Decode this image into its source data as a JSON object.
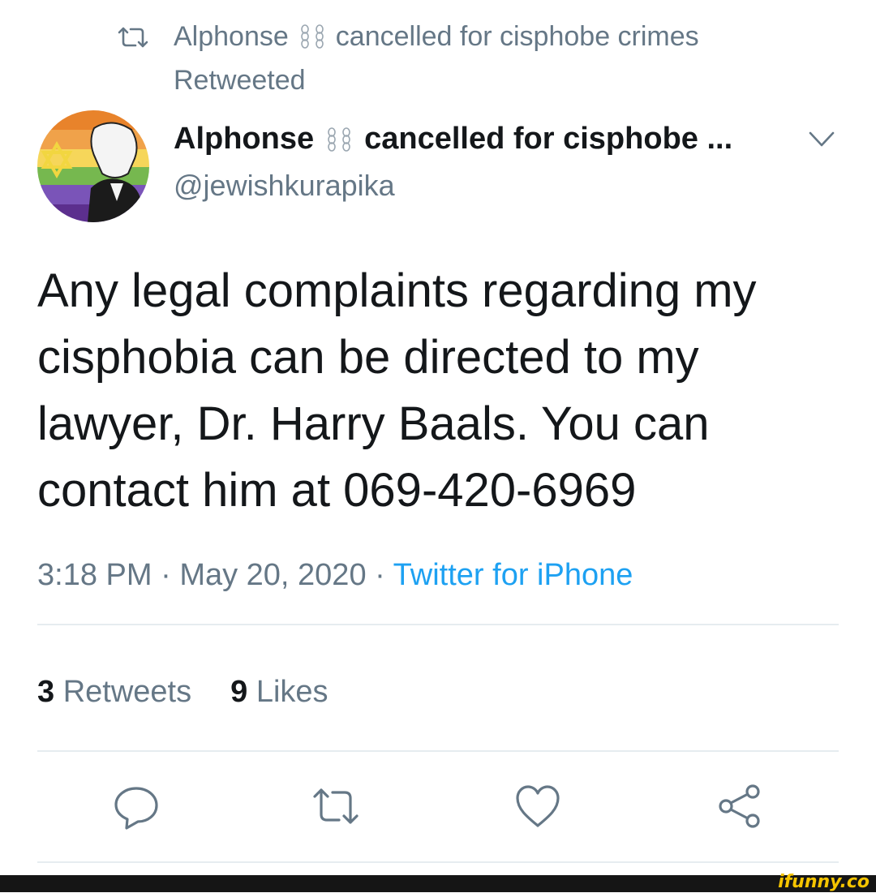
{
  "retweet_header": {
    "name_left": "Alphonse",
    "name_right": "cancelled for cisphobe crimes",
    "label": "Retweeted"
  },
  "author": {
    "display_name_left": "Alphonse",
    "display_name_right": "cancelled for cisphobe ...",
    "handle": "@jewishkurapika"
  },
  "tweet": {
    "text": "Any legal complaints regarding my cisphobia can be directed to my lawyer, Dr. Harry Baals. You can contact him at 069-420-6969"
  },
  "meta": {
    "time": "3:18 PM",
    "separator": " · ",
    "date": "May 20, 2020",
    "source": "Twitter for iPhone"
  },
  "stats": {
    "retweets_count": "3",
    "retweets_label": "Retweets",
    "likes_count": "9",
    "likes_label": "Likes"
  },
  "watermark": "ifunny.co",
  "colors": {
    "text_primary": "#14171a",
    "text_secondary": "#657786",
    "link": "#1da1f2",
    "divider": "#e6ecf0"
  },
  "icons": [
    "retweet-icon",
    "chain-icon",
    "chevron-down-icon",
    "reply-icon",
    "retweet-icon",
    "like-icon",
    "share-icon"
  ]
}
